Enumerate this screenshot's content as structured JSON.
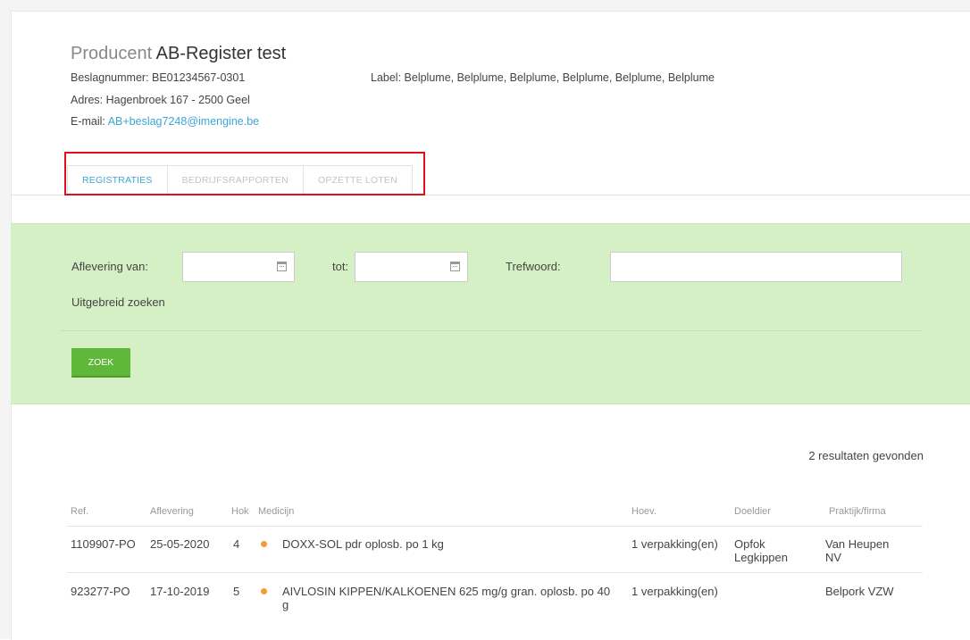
{
  "producer": {
    "prefix": "Producent",
    "name": "AB-Register test",
    "beslagnummer": "Beslagnummer: BE01234567-0301",
    "label": "Label: Belplume, Belplume, Belplume, Belplume, Belplume, Belplume",
    "adres": "Adres: Hagenbroek 167 - 2500 Geel",
    "email_label": "E-mail:",
    "email": "AB+beslag7248@imengine.be"
  },
  "tabs": [
    {
      "label": "REGISTRATIES",
      "active": true
    },
    {
      "label": "BEDRIJFSRAPPORTEN",
      "active": false
    },
    {
      "label": "OPZETTE LOTEN",
      "active": false
    }
  ],
  "filter": {
    "aflevering_van_label": "Aflevering van:",
    "aflevering_van_value": "",
    "tot_label": "tot:",
    "tot_value": "",
    "trefwoord_label": "Trefwoord:",
    "trefwoord_value": "",
    "advanced_link": "Uitgebreid zoeken",
    "search_button": "ZOEK"
  },
  "results": {
    "count_text": "2 resultaten gevonden",
    "columns": [
      "Ref.",
      "Aflevering",
      "Hok",
      "Medicijn",
      "Hoev.",
      "Doeldier",
      "Praktijk/firma"
    ],
    "rows": [
      {
        "ref": "1109907-PO",
        "aflevering": "25-05-2020",
        "hok": "4",
        "medicijn": "DOXX-SOL pdr oplosb. po 1 kg",
        "hoev": "1 verpakking(en)",
        "doeldier": "Opfok Legkippen",
        "praktijk": "Van Heupen NV",
        "status_color": "#f39a3a"
      },
      {
        "ref": "923277-PO",
        "aflevering": "17-10-2019",
        "hok": "5",
        "medicijn": "AIVLOSIN KIPPEN/KALKOENEN 625 mg/g gran. oplosb. po 40 g",
        "hoev": "1 verpakking(en)",
        "doeldier": "",
        "praktijk": "Belpork VZW",
        "status_color": "#f39a3a"
      }
    ]
  },
  "colors": {
    "accent": "#3ea6d6",
    "filter_bg": "#d6f0c6",
    "button": "#5fb83a",
    "highlight": "#e0101a"
  }
}
